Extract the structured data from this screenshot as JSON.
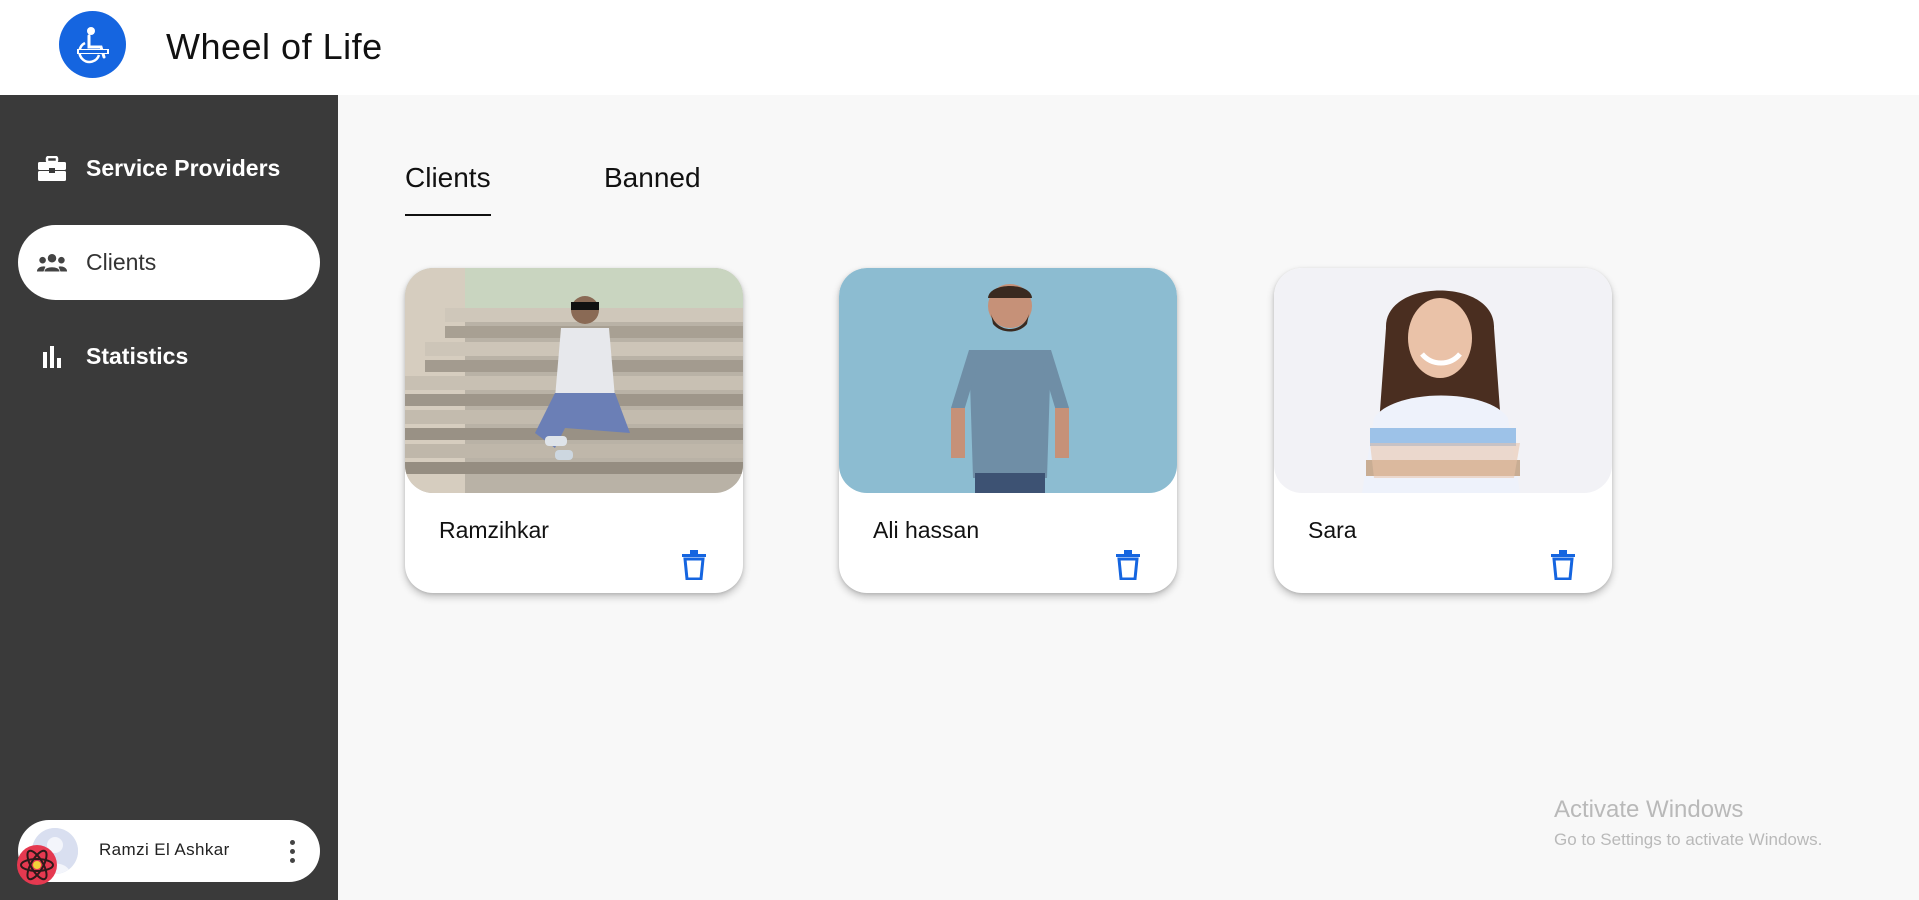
{
  "app": {
    "title": "Wheel of Life",
    "brand_color": "#1565e0"
  },
  "sidebar": {
    "background": "#3a3a3a",
    "items": [
      {
        "label": "Service Providers",
        "icon": "briefcase-icon",
        "active": false
      },
      {
        "label": "Clients",
        "icon": "group-icon",
        "active": true
      },
      {
        "label": "Statistics",
        "icon": "bar-chart-icon",
        "active": false
      }
    ],
    "user": {
      "name": "Ramzi El Ashkar",
      "menu_icon": "more-vertical-icon"
    }
  },
  "tabs": [
    {
      "label": "Clients",
      "active": true
    },
    {
      "label": "Banned",
      "active": false
    }
  ],
  "clients": [
    {
      "name": "Ramzihkar",
      "action_icon": "trash-icon"
    },
    {
      "name": "Ali hassan",
      "action_icon": "trash-icon"
    },
    {
      "name": "Sara",
      "action_icon": "trash-icon"
    }
  ],
  "watermark": {
    "title": "Activate Windows",
    "subtitle": "Go to Settings to activate Windows."
  }
}
